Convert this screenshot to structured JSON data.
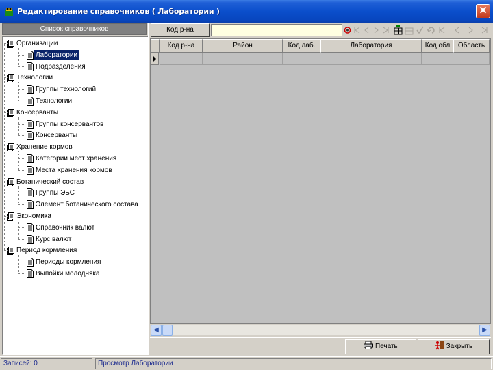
{
  "window": {
    "title": "Редактирование справочников ( Лаборатории )",
    "close_glyph": "✕"
  },
  "left_panel": {
    "header": "Список справочников",
    "tree": [
      {
        "label": "Организации",
        "children": [
          "Лаборатории",
          "Подразделения"
        ]
      },
      {
        "label": "Технологии",
        "children": [
          "Группы технологий",
          "Технологии"
        ]
      },
      {
        "label": "Консерванты",
        "children": [
          "Группы консервантов",
          "Консерванты"
        ]
      },
      {
        "label": "Хранение кормов",
        "children": [
          "Категории мест хранения",
          "Места хранения кормов"
        ]
      },
      {
        "label": "Ботанический состав",
        "children": [
          "Группы ЭБС",
          "Элемент ботанического состава"
        ]
      },
      {
        "label": "Экономика",
        "children": [
          "Справочник валют",
          "Курс валют"
        ]
      },
      {
        "label": "Период кормления",
        "children": [
          "Периоды кормления",
          "Выпойки молодняка"
        ]
      }
    ],
    "selected": "Лаборатории"
  },
  "search": {
    "field_label": "Код р-на",
    "value": "",
    "placeholder": ""
  },
  "grid": {
    "columns": [
      "Код р-на",
      "Район",
      "Код лаб.",
      "Лаборатория",
      "Код обл",
      "Область"
    ],
    "rows": [
      [
        "",
        "",
        "",
        "",
        "",
        ""
      ]
    ]
  },
  "buttons": {
    "print_prefix": "",
    "print_u": "П",
    "print_rest": "ечать",
    "close_u": "З",
    "close_rest": "акрыть"
  },
  "status": {
    "records": "Записей: 0",
    "mode": "Просмотр Лаборатории"
  },
  "colors": {
    "titlebar": "#0a4ecb",
    "selection": "#0a246a",
    "search_bg": "#ffffe1",
    "status_text": "#1b2a8e"
  },
  "icons": {
    "app": "app-icon",
    "folder": "folder-stack-icon",
    "document": "document-icon",
    "print": "printer-icon",
    "close": "exit-icon"
  }
}
